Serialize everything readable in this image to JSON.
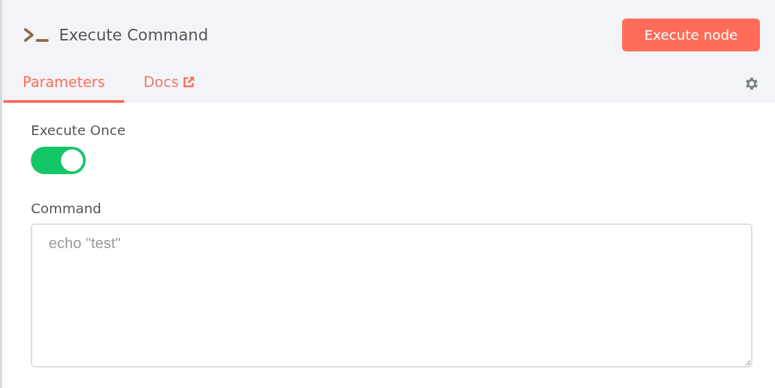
{
  "panel": {
    "title": "Execute Command",
    "action_button": "Execute node"
  },
  "tabs": [
    {
      "label": "Parameters",
      "selected": true,
      "external": false
    },
    {
      "label": "Docs",
      "selected": false,
      "external": true
    }
  ],
  "parameters": [
    {
      "kind": "toggle",
      "label": "Execute Once",
      "on": true
    },
    {
      "kind": "textarea",
      "label": "Command",
      "placeholder": "echo \"test\""
    }
  ]
}
